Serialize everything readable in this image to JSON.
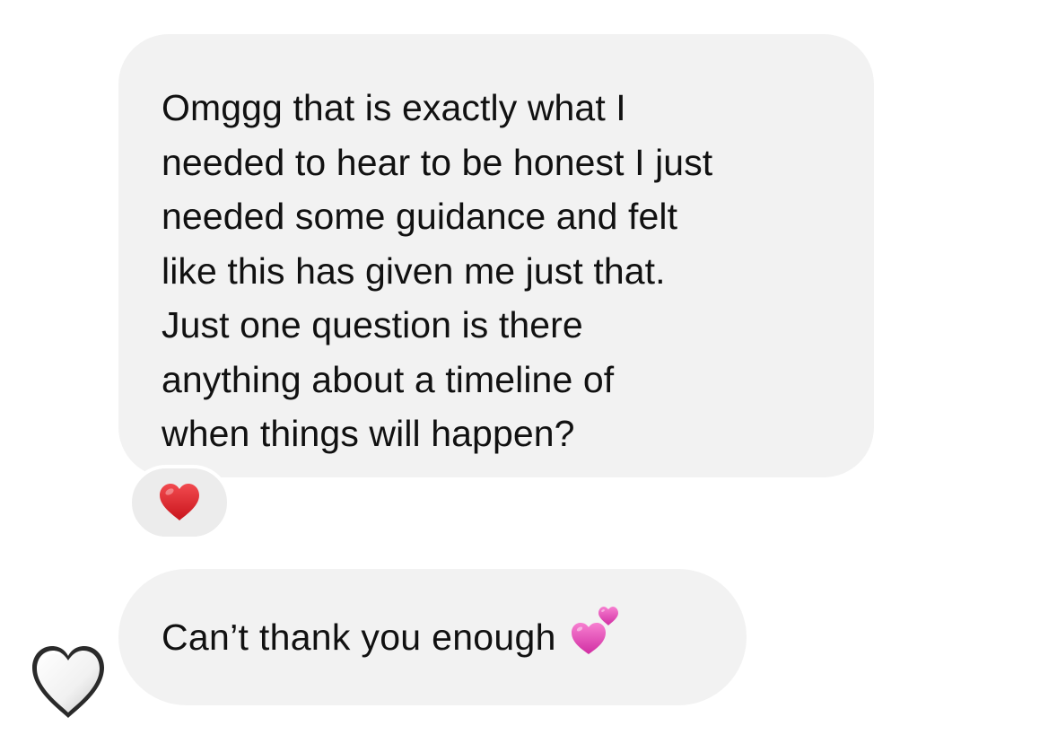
{
  "conversation": {
    "messages": [
      {
        "lines": [
          "Omggg that is exactly what I",
          "needed to hear to be honest I just",
          "needed some guidance and felt",
          "like this has given me just that.",
          "Just one question is there",
          "anything about a timeline of",
          "when things will happen?"
        ],
        "reaction": {
          "icon": "red-heart-icon"
        }
      },
      {
        "text": "Can’t thank you enough",
        "emoji": "two-hearts-icon"
      }
    ],
    "sender_avatar": {
      "icon": "white-heart-icon"
    }
  },
  "colors": {
    "bubble_background": "#f2f2f2",
    "reaction_background": "#ececec",
    "text": "#111111",
    "red_heart": "#e0242b",
    "pink_hearts": "#e94fb7"
  }
}
